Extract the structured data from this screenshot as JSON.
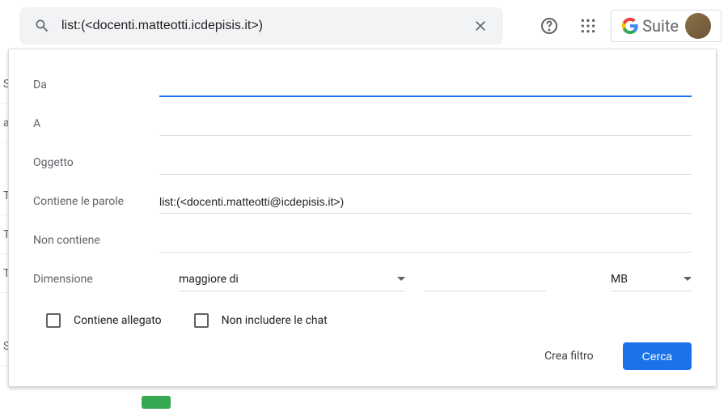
{
  "search": {
    "value": "list:(<docenti.matteotti.icdepisis.it>)"
  },
  "header": {
    "gsuite_label": "Suite"
  },
  "filter": {
    "from_label": "Da",
    "from_value": "",
    "to_label": "A",
    "to_value": "",
    "subject_label": "Oggetto",
    "subject_value": "",
    "has_words_label": "Contiene le parole",
    "has_words_value": "list:(<docenti.matteotti@icdepisis.it>)",
    "not_contains_label": "Non contiene",
    "not_contains_value": "",
    "dimension_label": "Dimensione",
    "size_operator": "maggiore di",
    "size_value": "",
    "size_unit": "MB",
    "has_attachment_label": "Contiene allegato",
    "exclude_chats_label": "Non includere le chat",
    "create_filter_label": "Crea filtro",
    "search_button_label": "Cerca"
  },
  "sidebar": {
    "items": [
      "Si",
      "aff",
      "To",
      "To",
      "To",
      "Si"
    ]
  }
}
